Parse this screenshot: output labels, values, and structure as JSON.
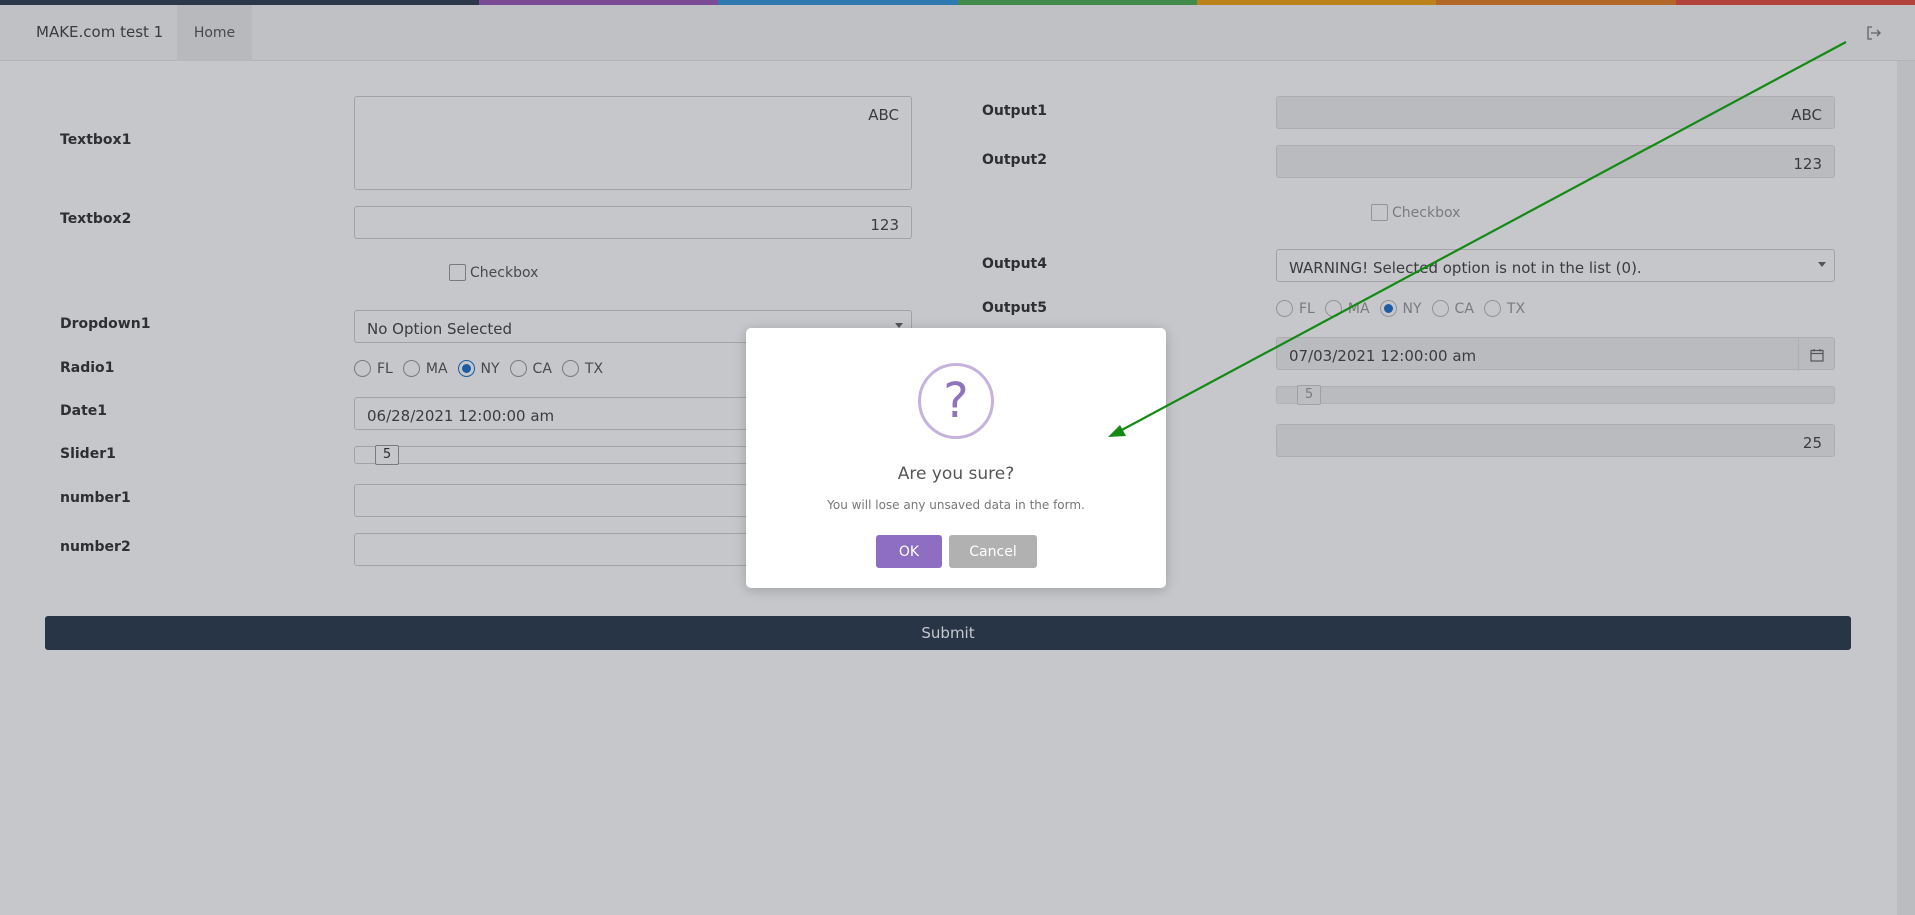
{
  "header": {
    "app_title": "MAKE.com test 1",
    "home_tab": "Home",
    "logout_icon": "sign-out-icon",
    "rainbow_colors": [
      "#2e3e50",
      "#2e3e50",
      "#9b59b6",
      "#3498db",
      "#4caf50",
      "#f1a30f",
      "#e67e22",
      "#e74c3c"
    ]
  },
  "left_form": {
    "textbox1_label": "Textbox1",
    "textbox1_value": "ABC",
    "textbox2_label": "Textbox2",
    "textbox2_value": "123",
    "checkbox_label": "Checkbox",
    "dropdown1_label": "Dropdown1",
    "dropdown1_value": "No Option Selected",
    "radio1_label": "Radio1",
    "radio_options": [
      "FL",
      "MA",
      "NY",
      "CA",
      "TX"
    ],
    "radio_selected": "NY",
    "date1_label": "Date1",
    "date1_value": "06/28/2021 12:00:00 am",
    "slider1_label": "Slider1",
    "slider1_value": "5",
    "number1_label": "number1",
    "number2_label": "number2"
  },
  "right_form": {
    "output1_label": "Output1",
    "output1_value": "ABC",
    "output2_label": "Output2",
    "output2_value": "123",
    "checkbox_label": "Checkbox",
    "output4_label": "Output4",
    "output4_value": "WARNING! Selected option is not in the list (0).",
    "output5_label": "Output5",
    "radio_options": [
      "FL",
      "MA",
      "NY",
      "CA",
      "TX"
    ],
    "radio_selected": "NY",
    "date_value": "07/03/2021 12:00:00 am",
    "slider_value": "5",
    "number_value": "25"
  },
  "submit_label": "Submit",
  "modal": {
    "icon": "question-icon",
    "icon_glyph": "?",
    "title": "Are you sure?",
    "text": "You will lose any unsaved data in the form.",
    "ok_label": "OK",
    "cancel_label": "Cancel"
  },
  "colors": {
    "accent_purple": "#8e6ec2",
    "submit_bg": "#2a3a4d",
    "arrow_green": "#138a13",
    "radio_blue": "#1c6fc9"
  }
}
